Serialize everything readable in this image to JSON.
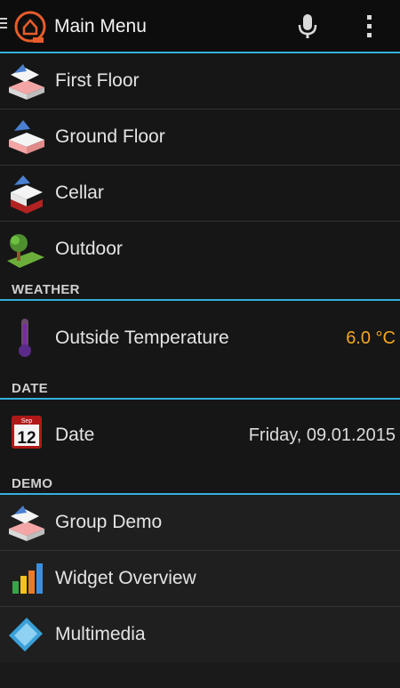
{
  "header": {
    "title": "Main Menu"
  },
  "icons": {
    "app": "openhab-logo-icon",
    "mic": "microphone-icon",
    "overflow": "overflow-menu-icon"
  },
  "colors": {
    "accent": "#34b0dc",
    "value_highlight": "#f5a623"
  },
  "main_items": [
    {
      "label": "First Floor",
      "icon": "house-floor-icon"
    },
    {
      "label": "Ground Floor",
      "icon": "house-floor-icon"
    },
    {
      "label": "Cellar",
      "icon": "house-cellar-icon"
    },
    {
      "label": "Outdoor",
      "icon": "tree-icon"
    }
  ],
  "weather": {
    "header": "WEATHER",
    "item": {
      "label": "Outside Temperature",
      "value": "6.0 °C",
      "icon": "thermometer-icon"
    }
  },
  "date": {
    "header": "DATE",
    "item": {
      "label": "Date",
      "value": "Friday, 09.01.2015",
      "icon": "calendar-icon",
      "calendar_day": "12",
      "calendar_month": "Sep"
    }
  },
  "demo": {
    "header": "DEMO",
    "items": [
      {
        "label": "Group Demo",
        "icon": "house-floor-icon"
      },
      {
        "label": "Widget Overview",
        "icon": "bar-chart-icon"
      },
      {
        "label": "Multimedia",
        "icon": "film-icon"
      }
    ]
  }
}
